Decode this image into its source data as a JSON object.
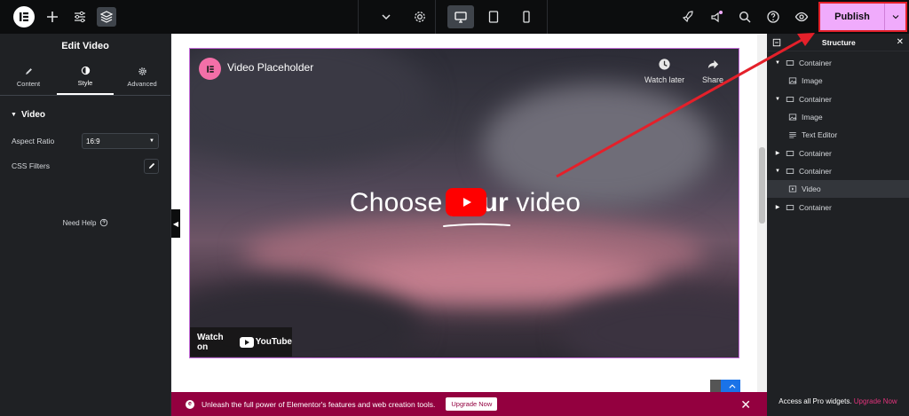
{
  "colors": {
    "accent": "#f0abfc",
    "promo": "#93003f",
    "highlight": "#e4202a",
    "panel": "#1f2124",
    "topbar": "#0c0d0e"
  },
  "topbar": {
    "publish_label": "Publish"
  },
  "left_panel": {
    "title": "Edit Video",
    "tabs": [
      {
        "label": "Content",
        "icon": "pencil-icon"
      },
      {
        "label": "Style",
        "icon": "contrast-icon"
      },
      {
        "label": "Advanced",
        "icon": "gear-icon"
      }
    ],
    "section": "Video",
    "aspect_ratio_label": "Aspect Ratio",
    "aspect_ratio_value": "16:9",
    "css_filters_label": "CSS Filters",
    "need_help": "Need Help"
  },
  "video": {
    "title": "Video Placeholder",
    "watch_later": "Watch later",
    "share": "Share",
    "headline_pre": "Choose ",
    "headline_bold": "your",
    "headline_post": " video",
    "watch_on": "Watch on",
    "youtube": "YouTube"
  },
  "promo": {
    "text": "Unleash the full power of Elementor's features and web creation tools.",
    "button": "Upgrade Now"
  },
  "structure": {
    "title": "Structure",
    "items": [
      {
        "label": "Container",
        "caret": "down",
        "indent": 0,
        "icon": "container-icon"
      },
      {
        "label": "Image",
        "indent": 1,
        "icon": "image-icon"
      },
      {
        "label": "Container",
        "caret": "down",
        "indent": 0,
        "icon": "container-icon"
      },
      {
        "label": "Image",
        "indent": 1,
        "icon": "image-icon"
      },
      {
        "label": "Text Editor",
        "indent": 1,
        "icon": "text-editor-icon"
      },
      {
        "label": "Container",
        "caret": "right",
        "indent": 0,
        "icon": "container-icon"
      },
      {
        "label": "Container",
        "caret": "down",
        "indent": 0,
        "icon": "container-icon"
      },
      {
        "label": "Video",
        "indent": 1,
        "icon": "video-icon",
        "selected": true
      },
      {
        "label": "Container",
        "caret": "right",
        "indent": 0,
        "icon": "container-icon"
      }
    ],
    "footer_text": "Access all Pro widgets.",
    "footer_link": "Upgrade Now"
  }
}
